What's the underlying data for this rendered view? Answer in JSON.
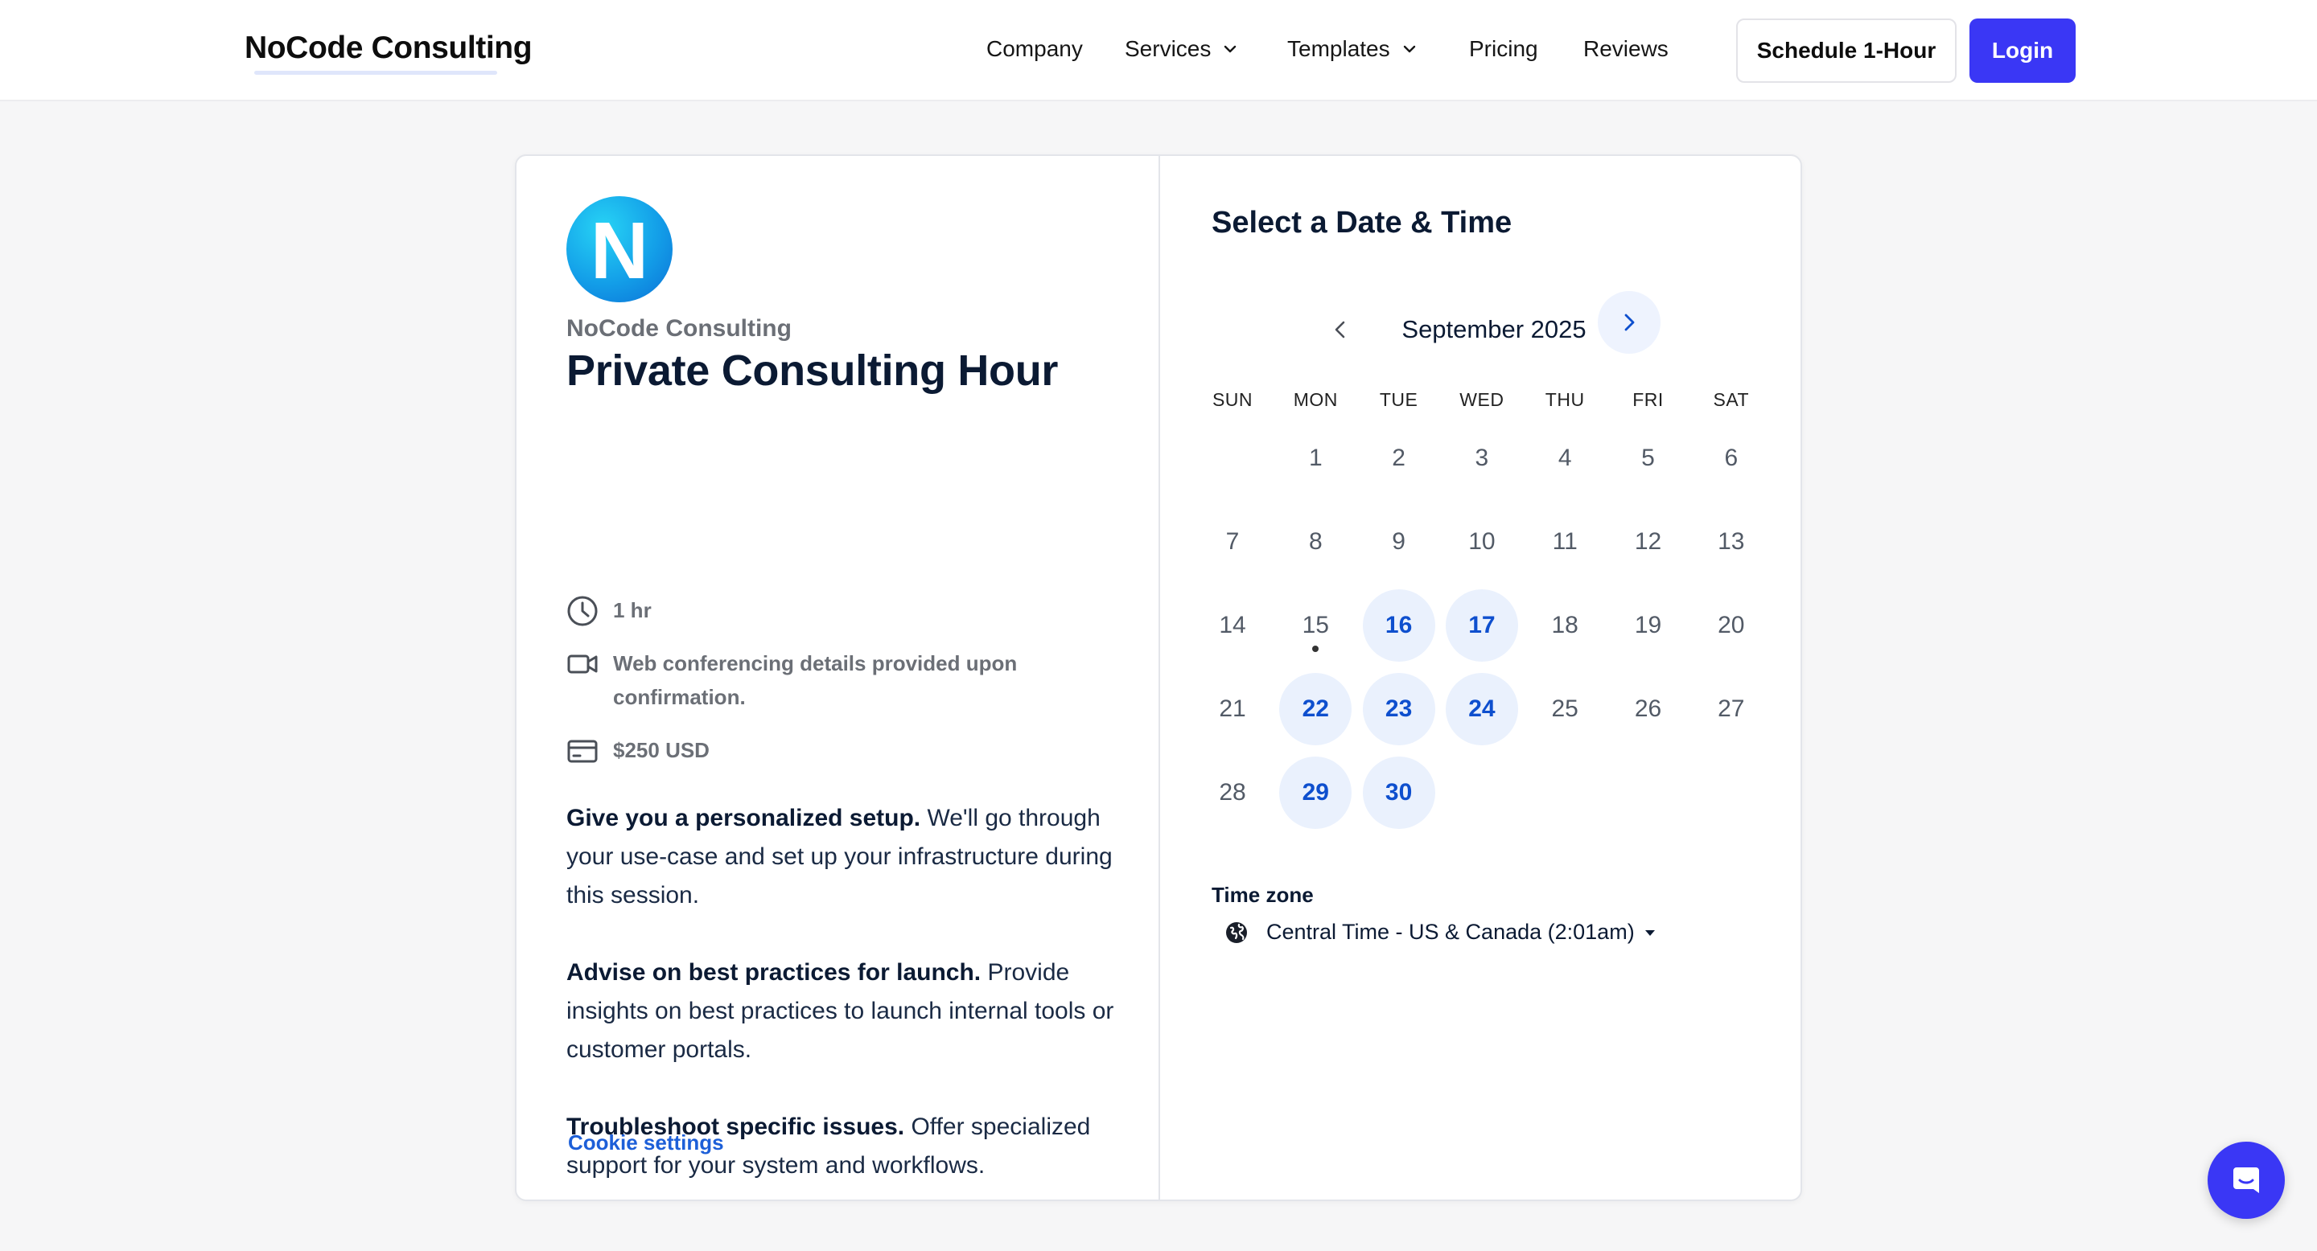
{
  "nav": {
    "brand": "NoCode Consulting",
    "links": [
      {
        "label": "Company"
      },
      {
        "label": "Services"
      },
      {
        "label": "Templates"
      },
      {
        "label": "Pricing"
      },
      {
        "label": "Reviews"
      }
    ],
    "schedule_label": "Schedule 1-Hour",
    "login_label": "Login"
  },
  "event": {
    "avatar_letter": "N",
    "org_name": "NoCode Consulting",
    "title": "Private Consulting Hour",
    "duration": "1 hr",
    "conferencing": "Web conferencing details provided upon confirmation.",
    "price": "$250 USD",
    "descriptions": [
      {
        "bold": "Give you a personalized setup.",
        "text": " We'll go through your use-case and set up your infrastructure during this session."
      },
      {
        "bold": "Advise on best practices for launch.",
        "text": " Provide insights on best practices to launch internal tools or customer portals."
      },
      {
        "bold": "Troubleshoot specific issues.",
        "text": " Offer specialized support for your system and workflows."
      }
    ],
    "cookie_settings": "Cookie settings"
  },
  "calendar": {
    "heading": "Select a Date & Time",
    "month_label": "September 2025",
    "weekdays": [
      "SUN",
      "MON",
      "TUE",
      "WED",
      "THU",
      "FRI",
      "SAT"
    ],
    "first_weekday_index": 1,
    "days_in_month": 30,
    "available_days": [
      16,
      17,
      22,
      23,
      24,
      29,
      30
    ],
    "today": 15
  },
  "timezone": {
    "label": "Time zone",
    "value": "Central Time - US & Canada (2:01am)"
  },
  "colors": {
    "accent": "#3a37f5",
    "available_bg": "#eaf1fd",
    "available_text": "#0e4fce",
    "link": "#1d5fd8"
  }
}
